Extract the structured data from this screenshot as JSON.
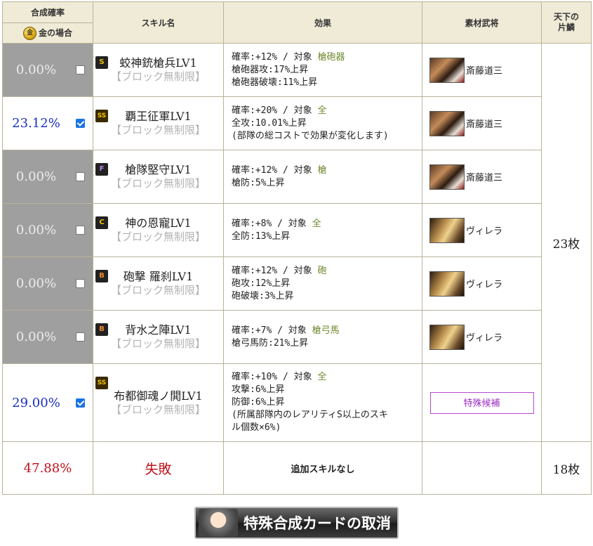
{
  "headers": {
    "rate": "合成確率",
    "gold_case": "金の場合",
    "gold_icon": "金",
    "skill": "スキル名",
    "effect": "効果",
    "material": "素材武将",
    "katahen": "天下の片鱗"
  },
  "rows": [
    {
      "rate": "0.00%",
      "checked": false,
      "rarity": "S",
      "rarity_color": "#f2c300",
      "skill": "蛟神銃槍兵LV1",
      "sub": "【ブロック無制限】",
      "effect": [
        {
          "text": "確率:+12% / 対象 ",
          "target": "槍砲器"
        },
        {
          "text": "槍砲器攻:17%上昇"
        },
        {
          "text": "槍砲器破壊:11%上昇"
        }
      ],
      "material": {
        "name": "斎藤道三",
        "portrait": "saito-portrait"
      }
    },
    {
      "rate": "23.12%",
      "checked": true,
      "rarity": "SS",
      "rarity_color": "#f2c300",
      "skill": "覇王征軍LV1",
      "sub": "【ブロック無制限】",
      "effect": [
        {
          "text": "確率:+20% / 対象 ",
          "target": "全"
        },
        {
          "text": "全攻:10.01%上昇"
        },
        {
          "text": "(部隊の総コストで効果が変化します)"
        }
      ],
      "material": {
        "name": "斎藤道三",
        "portrait": "saito-portrait"
      }
    },
    {
      "rate": "0.00%",
      "checked": false,
      "rarity": "F",
      "rarity_color": "#b583e0",
      "skill": "槍隊堅守LV1",
      "sub": "【ブロック無制限】",
      "effect": [
        {
          "text": "確率:+12% / 対象 ",
          "target": "槍"
        },
        {
          "text": "槍防:5%上昇"
        }
      ],
      "material": {
        "name": "斎藤道三",
        "portrait": "saito-portrait"
      }
    },
    {
      "rate": "0.00%",
      "checked": false,
      "rarity": "C",
      "rarity_color": "#f2c300",
      "skill": "神の恩寵LV1",
      "sub": "【ブロック無制限】",
      "effect": [
        {
          "text": "確率:+8% / 対象 ",
          "target": "全"
        },
        {
          "text": "全防:13%上昇"
        }
      ],
      "material": {
        "name": "ヴィレラ",
        "portrait": "virella-portrait"
      }
    },
    {
      "rate": "0.00%",
      "checked": false,
      "rarity": "B",
      "rarity_color": "#f08a2a",
      "skill": "砲撃 羅刹LV1",
      "sub": "【ブロック無制限】",
      "effect": [
        {
          "text": "確率:+12% / 対象 ",
          "target": "砲"
        },
        {
          "text": "砲攻:12%上昇"
        },
        {
          "text": "砲破壊:3%上昇"
        }
      ],
      "material": {
        "name": "ヴィレラ",
        "portrait": "virella-portrait"
      }
    },
    {
      "rate": "0.00%",
      "checked": false,
      "rarity": "B",
      "rarity_color": "#f08a2a",
      "skill": "背水之陣LV1",
      "sub": "【ブロック無制限】",
      "effect": [
        {
          "text": "確率:+7% / 対象 ",
          "target": "槍弓馬"
        },
        {
          "text": "槍弓馬防:21%上昇"
        }
      ],
      "material": {
        "name": "ヴィレラ",
        "portrait": "virella-portrait"
      }
    },
    {
      "rate": "29.00%",
      "checked": true,
      "rarity": "SS",
      "rarity_color": "#f2c300",
      "skill": "布都御魂ノ閧LV1",
      "sub": "【ブロック無制限】",
      "effect": [
        {
          "text": "確率:+10% / 対象 ",
          "target": "全"
        },
        {
          "text": "攻撃:6%上昇"
        },
        {
          "text": "防御:6%上昇"
        },
        {
          "text": "(所属部隊内のレアリティS以上のスキ"
        },
        {
          "text": "ル個数×6%)"
        }
      ],
      "material": {
        "special": "特殊候補"
      }
    }
  ],
  "katahen_main": "23枚",
  "fail_row": {
    "rate": "47.88%",
    "label": "失敗",
    "effect": "追加スキルなし",
    "katahen": "18枚"
  },
  "cancel_button": {
    "label": "特殊合成カードの取消"
  }
}
